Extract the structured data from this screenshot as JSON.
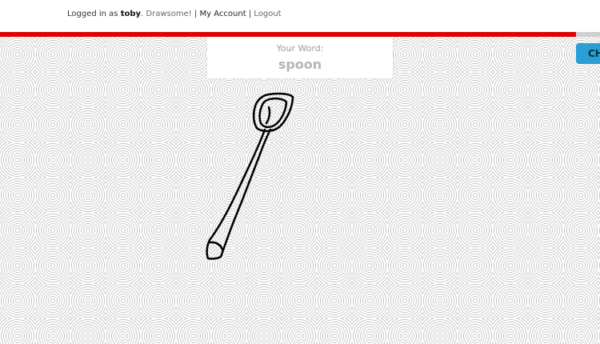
{
  "header": {
    "logged_in_prefix": "Logged in as",
    "username": "toby",
    "drawsome_link": "Drawsome!",
    "separator1": "|",
    "my_account_link": "My Account",
    "separator2": "|",
    "logout_link": "Logout"
  },
  "progress": {
    "fraction": 0.96,
    "fill_color": "#e00000",
    "track_color": "#cfcfcf"
  },
  "word_card": {
    "label": "Your Word:",
    "word": "spoon"
  },
  "side_button": {
    "label": "CH",
    "color": "#2a9fd6"
  },
  "drawing": {
    "stroke_color": "#000000",
    "subject": "spoon"
  }
}
